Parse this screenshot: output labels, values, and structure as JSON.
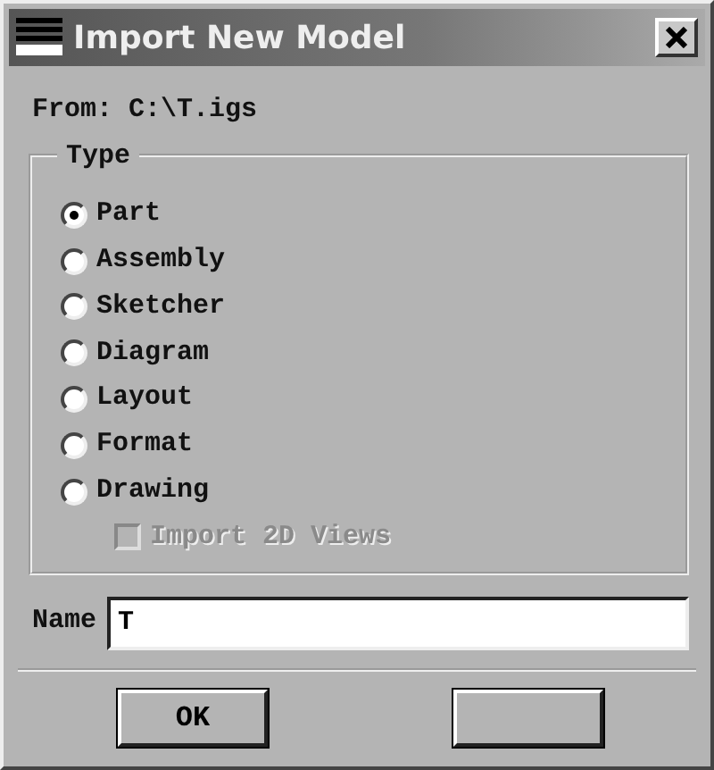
{
  "window": {
    "title": "Import New Model"
  },
  "source": {
    "text": "From: C:\\T.igs"
  },
  "type_group": {
    "title": "Type",
    "options": [
      {
        "label": "Part",
        "selected": true
      },
      {
        "label": "Assembly",
        "selected": false
      },
      {
        "label": "Sketcher",
        "selected": false
      },
      {
        "label": "Diagram",
        "selected": false
      },
      {
        "label": "Layout",
        "selected": false
      },
      {
        "label": "Format",
        "selected": false
      },
      {
        "label": "Drawing",
        "selected": false
      }
    ],
    "import_2d": {
      "label": "Import 2D Views",
      "checked": false,
      "disabled": true
    }
  },
  "name_field": {
    "label": "Name",
    "value": "T"
  },
  "buttons": [
    {
      "kind": "labeled",
      "label": "OK"
    },
    {
      "kind": "blank"
    }
  ]
}
